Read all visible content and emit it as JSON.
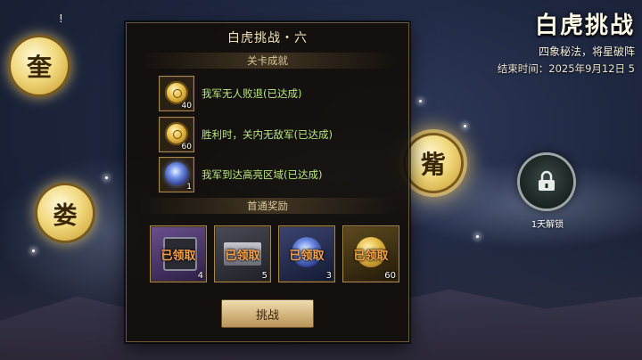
{
  "event": {
    "title": "白虎挑战",
    "subtitle": "四象秘法，将星破阵",
    "end_time": "结束时间：2025年9月12日 5"
  },
  "top_mark": "!",
  "nodes": {
    "kui": "奎",
    "lou": "娄",
    "zi": "觜",
    "locked_label": "1天解锁"
  },
  "panel": {
    "title": "白虎挑战・六",
    "achievements_header": "关卡成就",
    "achievements": [
      {
        "text": "我军无人败退(已达成)",
        "count": "40",
        "icon": "gold-coin-icon"
      },
      {
        "text": "胜利时，关内无敌军(已达成)",
        "count": "60",
        "icon": "gold-coin-icon"
      },
      {
        "text": "我军到达高亮区域(已达成)",
        "count": "1",
        "icon": "star-orb-icon"
      }
    ],
    "rewards_header": "首通奖励",
    "rewards": [
      {
        "status": "已领取",
        "count": "4",
        "icon": "chest-icon"
      },
      {
        "status": "已领取",
        "count": "5",
        "icon": "ingot-icon"
      },
      {
        "status": "已领取",
        "count": "3",
        "icon": "star-orb-icon"
      },
      {
        "status": "已领取",
        "count": "60",
        "icon": "gold-coin-icon"
      }
    ],
    "challenge_label": "挑战"
  },
  "colors": {
    "achievement_text": "#b9e87a",
    "claimed_text": "#f7a24a",
    "panel_bg": "#120e0a"
  }
}
